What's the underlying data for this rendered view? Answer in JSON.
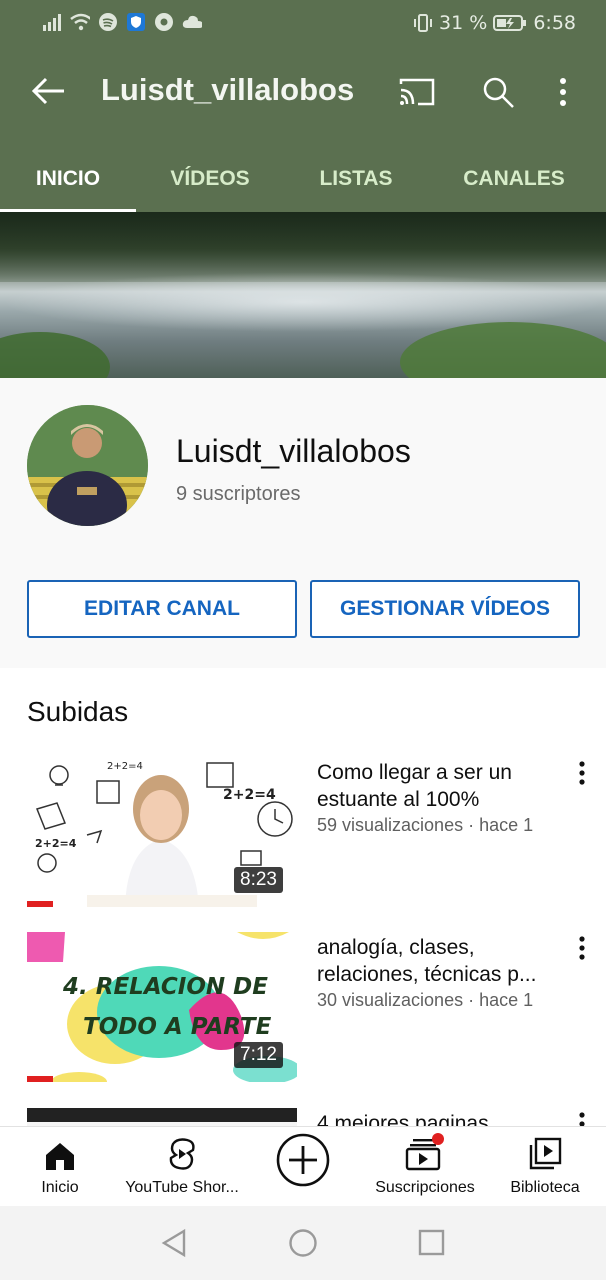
{
  "status_bar": {
    "battery": "31 %",
    "time": "6:58"
  },
  "header": {
    "title": "Luisdt_villalobos"
  },
  "tabs": [
    {
      "label": "INICIO",
      "active": true
    },
    {
      "label": "VÍDEOS",
      "active": false
    },
    {
      "label": "LISTAS",
      "active": false
    },
    {
      "label": "CANALES",
      "active": false
    }
  ],
  "channel": {
    "name": "Luisdt_villalobos",
    "subscribers": "9 suscriptores",
    "edit_button": "EDITAR CANAL",
    "manage_button": "GESTIONAR VÍDEOS"
  },
  "uploads": {
    "heading": "Subidas",
    "videos": [
      {
        "title": "Como llegar a ser un estuante al 100%",
        "meta": "59 visualizaciones · hace 1",
        "duration": "8:23",
        "thumb_text": ""
      },
      {
        "title": "analogía, clases, relaciones, técnicas p...",
        "meta": "30 visualizaciones · hace 1",
        "duration": "7:12",
        "thumb_text_1": "4. RELACION DE",
        "thumb_text_2": "TODO A PARTE"
      },
      {
        "title": "4 mejores paginas",
        "meta": "",
        "duration": ""
      }
    ]
  },
  "bottom_nav": [
    {
      "label": "Inicio",
      "icon": "home-icon"
    },
    {
      "label": "YouTube Shor...",
      "icon": "shorts-icon"
    },
    {
      "label": "",
      "icon": "create-icon"
    },
    {
      "label": "Suscripciones",
      "icon": "subscriptions-icon"
    },
    {
      "label": "Biblioteca",
      "icon": "library-icon"
    }
  ],
  "colors": {
    "header_bg": "#5b7050",
    "accent_blue": "#1565c0",
    "notification_dot": "#e02020"
  }
}
